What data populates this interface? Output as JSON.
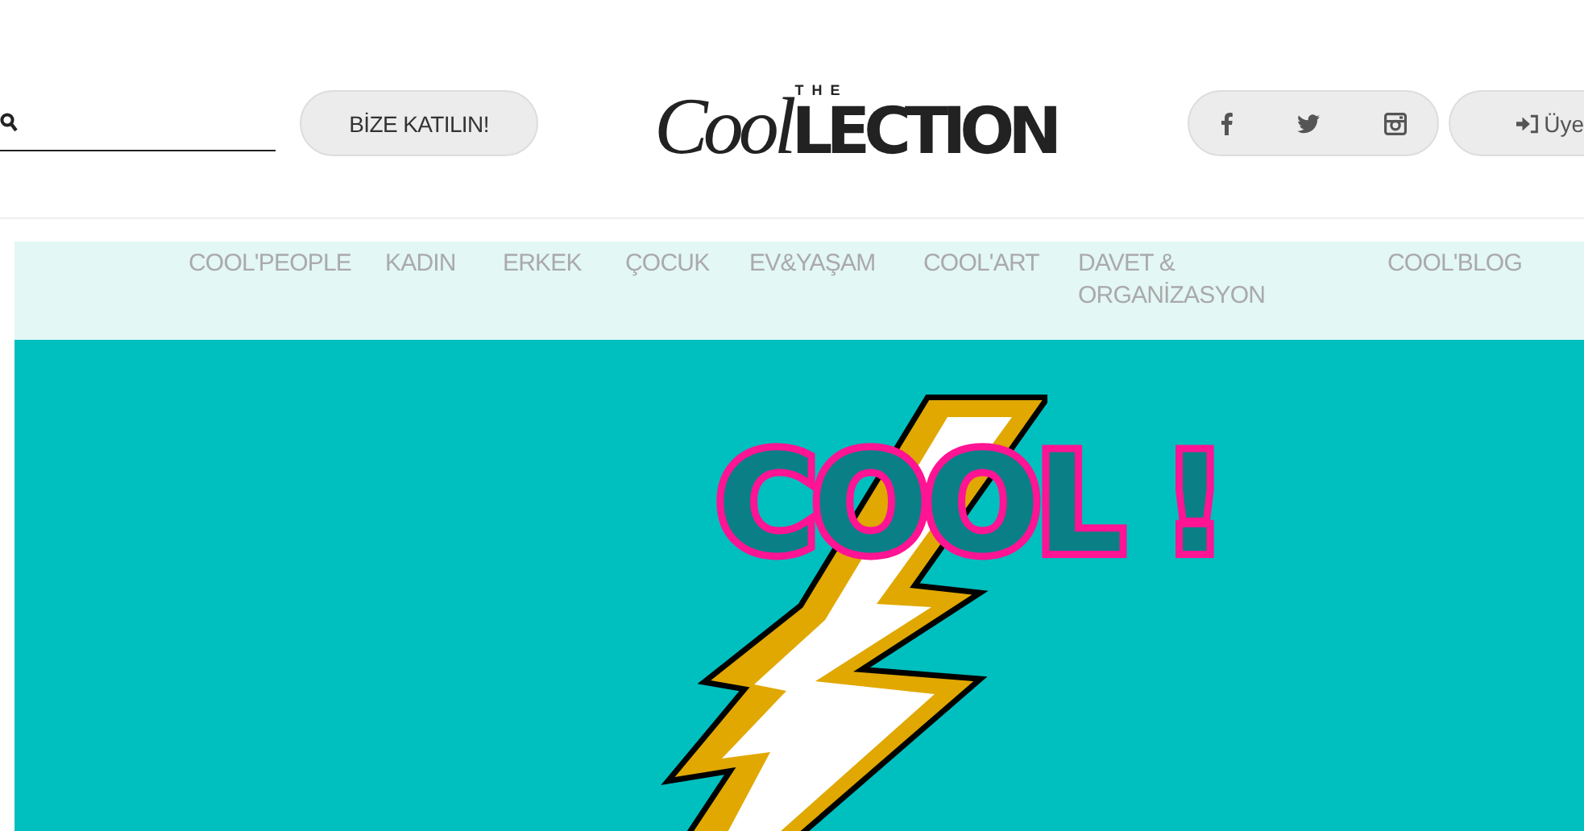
{
  "header": {
    "join_button": "BİZE KATILIN!",
    "logo": {
      "small": "THE",
      "script": "Cool",
      "caps": "LECTION"
    },
    "member_button": "Üye"
  },
  "nav": {
    "items": [
      {
        "label": "COOL'PEOPLE"
      },
      {
        "label": "KADIN"
      },
      {
        "label": "ERKEK"
      },
      {
        "label": "ÇOCUK"
      },
      {
        "label": "EV&YAŞAM"
      },
      {
        "label": "COOL'ART"
      },
      {
        "label": "DAVET & ORGANİZASYON"
      },
      {
        "label": "COOL'BLOG"
      }
    ]
  },
  "hero": {
    "title": "COOL !"
  }
}
